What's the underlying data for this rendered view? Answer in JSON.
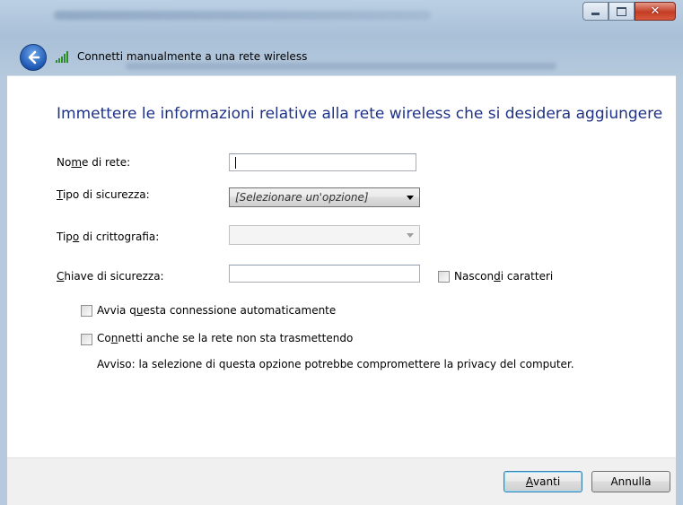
{
  "window": {
    "title": "Connetti manualmente a una rete wireless"
  },
  "heading": "Immettere le informazioni relative alla rete wireless che si desidera aggiungere",
  "form": {
    "network_name": {
      "label_pre": "No",
      "label_accel": "m",
      "label_post": "e di rete:",
      "value": ""
    },
    "security_type": {
      "label_pre": "",
      "label_accel": "T",
      "label_post": "ipo di sicurezza:",
      "value": "[Selezionare un'opzione]"
    },
    "encryption_type": {
      "label_pre": "Tip",
      "label_accel": "o",
      "label_post": " di crittografia:",
      "value": ""
    },
    "security_key": {
      "label_pre": "",
      "label_accel": "C",
      "label_post": "hiave di sicurezza:",
      "value": ""
    },
    "hide_chars": {
      "label_pre": "Nascon",
      "label_accel": "d",
      "label_post": "i caratteri",
      "checked": false
    },
    "auto_start": {
      "label_pre": "Avvia q",
      "label_accel": "u",
      "label_post": "esta connessione automaticamente",
      "checked": false
    },
    "connect_hidden": {
      "label_pre": "Co",
      "label_accel": "n",
      "label_post": "netti anche se la rete non sta trasmettendo",
      "checked": false
    },
    "warning": "Avviso: la selezione di questa opzione potrebbe compromettere la privacy del computer."
  },
  "buttons": {
    "next": {
      "label_accel": "A",
      "label_post": "vanti"
    },
    "cancel": {
      "label": "Annulla"
    }
  },
  "icons": {
    "back": "back-arrow-icon",
    "signal": "wireless-signal-icon",
    "minimize": "minimize-icon",
    "maximize": "maximize-icon",
    "close": "close-icon"
  },
  "colors": {
    "heading": "#1e3287",
    "close_button": "#c33d24",
    "back_button": "#1d58b5"
  }
}
